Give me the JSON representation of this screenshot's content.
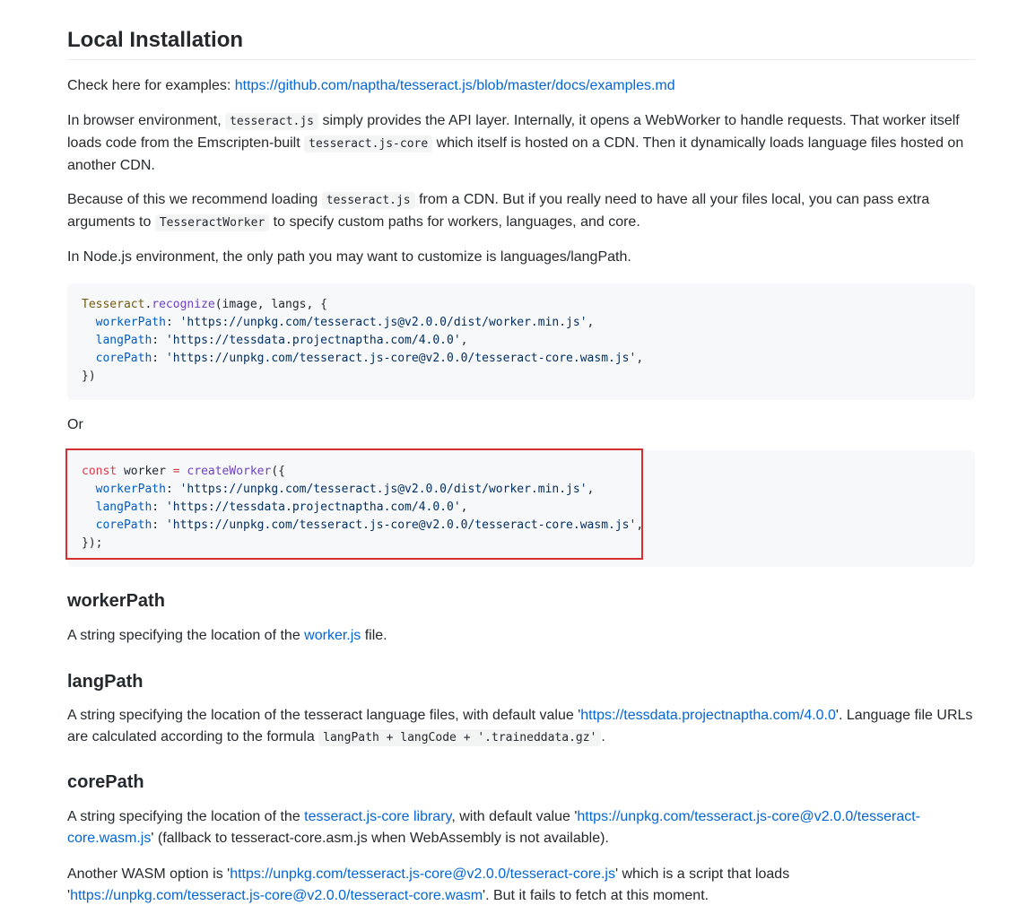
{
  "heading": "Local Installation",
  "examples": {
    "prefix": "Check here for examples: ",
    "link": "https://github.com/naptha/tesseract.js/blob/master/docs/examples.md"
  },
  "para1": {
    "t1": "In browser environment, ",
    "c1": "tesseract.js",
    "t2": " simply provides the API layer. Internally, it opens a WebWorker to handle requests. That worker itself loads code from the Emscripten-built ",
    "c2": "tesseract.js-core",
    "t3": " which itself is hosted on a CDN. Then it dynamically loads language files hosted on another CDN."
  },
  "para2": {
    "t1": "Because of this we recommend loading ",
    "c1": "tesseract.js",
    "t2": " from a CDN. But if you really need to have all your files local, you can pass extra arguments to ",
    "c2": "TesseractWorker",
    "t3": " to specify custom paths for workers, languages, and core."
  },
  "para3": "In Node.js environment, the only path you may want to customize is languages/langPath.",
  "code1": {
    "obj": "Tesseract",
    "dot": ".",
    "fn": "recognize",
    "args": "(image, langs, {",
    "workerKey": "workerPath",
    "workerVal": "'https://unpkg.com/tesseract.js@v2.0.0/dist/worker.min.js'",
    "langKey": "langPath",
    "langVal": "'https://tessdata.projectnaptha.com/4.0.0'",
    "coreKey": "corePath",
    "coreVal": "'https://unpkg.com/tesseract.js-core@v2.0.0/tesseract-core.wasm.js'",
    "close": "})"
  },
  "or": "Or",
  "code2": {
    "kw": "const",
    "var": " worker ",
    "eq": "=",
    "fn": " createWorker",
    "open": "({",
    "workerKey": "workerPath",
    "workerVal": "'https://unpkg.com/tesseract.js@v2.0.0/dist/worker.min.js'",
    "langKey": "langPath",
    "langVal": "'https://tessdata.projectnaptha.com/4.0.0'",
    "coreKey": "corePath",
    "coreVal": "'https://unpkg.com/tesseract.js-core@v2.0.0/tesseract-core.wasm.js'",
    "close": "});"
  },
  "workerPath": {
    "title": "workerPath",
    "t1": "A string specifying the location of the ",
    "link": "worker.js",
    "t2": " file."
  },
  "langPath": {
    "title": "langPath",
    "t1": "A string specifying the location of the tesseract language files, with default value '",
    "link": "https://tessdata.projectnaptha.com/4.0.0",
    "t2": "'. Language file URLs are calculated according to the formula ",
    "code": "langPath + langCode + '.traineddata.gz'",
    "t3": "."
  },
  "corePath": {
    "title": "corePath",
    "t1": "A string specifying the location of the ",
    "link1": "tesseract.js-core library",
    "t2": ", with default value '",
    "link2": "https://unpkg.com/tesseract.js-core@v2.0.0/tesseract-core.wasm.js",
    "t3": "' (fallback to tesseract-core.asm.js when WebAssembly is not available)."
  },
  "wasm": {
    "t1": "Another WASM option is '",
    "link1": "https://unpkg.com/tesseract.js-core@v2.0.0/tesseract-core.js",
    "t2": "' which is a script that loads '",
    "link2": "https://unpkg.com/tesseract.js-core@v2.0.0/tesseract-core.wasm",
    "t3": "'. But it fails to fetch at this moment."
  },
  "colors": {
    "highlight_border": "#d32f2f",
    "link": "#0366d6",
    "code_bg": "#f6f8fa"
  }
}
